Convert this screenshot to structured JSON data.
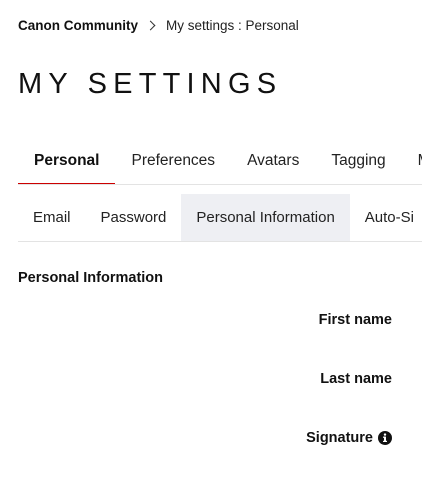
{
  "breadcrumb": {
    "home": "Canon Community",
    "current": "My settings : Personal"
  },
  "page": {
    "title": "MY SETTINGS"
  },
  "primary_tabs": [
    {
      "label": "Personal",
      "active": true
    },
    {
      "label": "Preferences",
      "active": false
    },
    {
      "label": "Avatars",
      "active": false
    },
    {
      "label": "Tagging",
      "active": false
    },
    {
      "label": "M",
      "active": false
    }
  ],
  "secondary_tabs": [
    {
      "label": "Email",
      "active": false
    },
    {
      "label": "Password",
      "active": false
    },
    {
      "label": "Personal Information",
      "active": true
    },
    {
      "label": "Auto-Si",
      "active": false
    }
  ],
  "section": {
    "heading": "Personal Information"
  },
  "form": {
    "first_name_label": "First name",
    "last_name_label": "Last name",
    "signature_label": "Signature"
  },
  "colors": {
    "accent": "#cc0000",
    "active_secondary_bg": "#eeeff3"
  },
  "icons": {
    "breadcrumb_separator": "chevron-right-icon",
    "signature_info": "info-icon"
  }
}
